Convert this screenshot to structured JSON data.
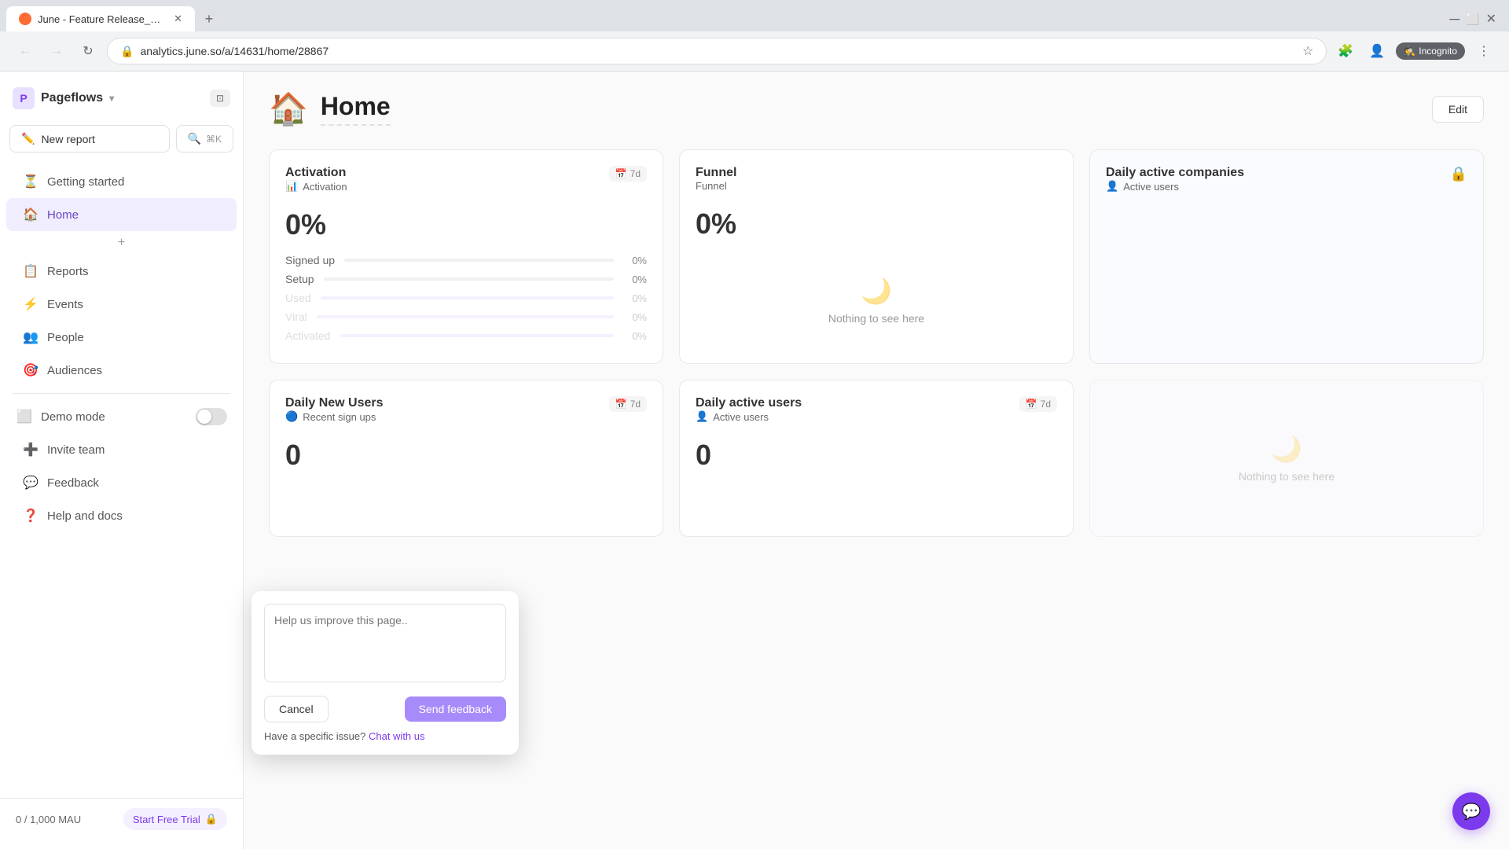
{
  "browser": {
    "tab_title": "June - Feature Release_QR Code...",
    "url": "analytics.june.so/a/14631/home/28867",
    "incognito_label": "Incognito"
  },
  "sidebar": {
    "workspace_name": "Pageflows",
    "new_report_label": "New report",
    "search_label": "⌘K",
    "search_icon_label": "Search",
    "nav_items": [
      {
        "id": "getting-started",
        "label": "Getting started",
        "icon": "⏳"
      },
      {
        "id": "home",
        "label": "Home",
        "icon": "🏠",
        "active": true
      },
      {
        "id": "reports",
        "label": "Reports",
        "icon": "📋"
      },
      {
        "id": "events",
        "label": "Events",
        "icon": "⚡"
      },
      {
        "id": "people",
        "label": "People",
        "icon": "👥"
      },
      {
        "id": "audiences",
        "label": "Audiences",
        "icon": "🎯"
      }
    ],
    "demo_mode_label": "Demo mode",
    "invite_team_label": "Invite team",
    "feedback_label": "Feedback",
    "help_docs_label": "Help and docs",
    "mau_label": "0 / 1,000 MAU",
    "free_trial_label": "Start Free Trial"
  },
  "page": {
    "icon": "🏠",
    "title": "Home",
    "edit_label": "Edit"
  },
  "cards": [
    {
      "id": "activation",
      "title": "Activation",
      "subtitle": "Activation",
      "subtitle_icon": "📊",
      "badge": "7d",
      "value": "0%",
      "rows": [
        {
          "label": "Signed up",
          "value": "0%"
        },
        {
          "label": "Setup",
          "value": "0%"
        },
        {
          "label": "Used",
          "value": "0%"
        },
        {
          "label": "Viral",
          "value": "0%"
        },
        {
          "label": "Activated",
          "value": "0%"
        }
      ]
    },
    {
      "id": "funnel",
      "title": "Funnel",
      "subtitle": "Funnel",
      "badge": "",
      "value": "0%",
      "empty": true,
      "empty_text": "Nothing to see here"
    },
    {
      "id": "daily-active-companies",
      "title": "Daily active companies",
      "subtitle": "Active users",
      "locked": true,
      "empty": true
    },
    {
      "id": "daily-new-users",
      "title": "Daily New Users",
      "subtitle": "Recent sign ups",
      "subtitle_icon": "🔵",
      "badge": "7d",
      "value": "0",
      "empty": false
    },
    {
      "id": "daily-active-users",
      "title": "Daily active users",
      "subtitle": "Active users",
      "subtitle_icon": "👤",
      "badge": "7d",
      "value": "0",
      "empty": false
    }
  ],
  "feedback": {
    "placeholder": "Help us improve this page..",
    "cancel_label": "Cancel",
    "send_label": "Send feedback",
    "chat_prefix": "Have a specific issue?",
    "chat_link_label": "Chat with us"
  }
}
